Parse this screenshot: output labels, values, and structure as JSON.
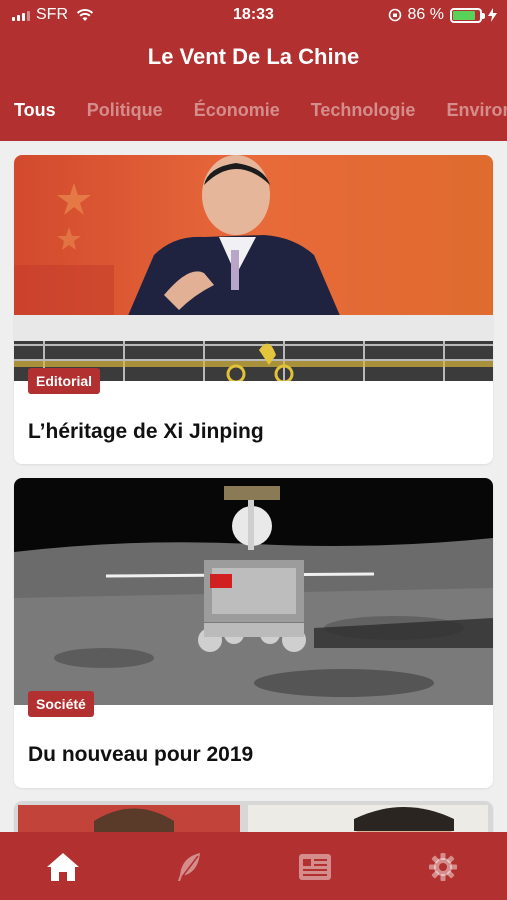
{
  "status_bar": {
    "carrier": "SFR",
    "time": "18:33",
    "battery_percent": "86 %",
    "battery_level": 0.86
  },
  "header": {
    "title": "Le Vent De La Chine"
  },
  "tabs": [
    {
      "label": "Tous",
      "active": true
    },
    {
      "label": "Politique",
      "active": false
    },
    {
      "label": "Économie",
      "active": false
    },
    {
      "label": "Technologie",
      "active": false
    },
    {
      "label": "Environ",
      "active": false
    }
  ],
  "articles": [
    {
      "category": "Editorial",
      "title": "L’héritage de Xi Jinping"
    },
    {
      "category": "Société",
      "title": "Du nouveau pour 2019"
    }
  ],
  "tab_bar": {
    "items": [
      {
        "icon": "home-icon",
        "active": true
      },
      {
        "icon": "feather-icon",
        "active": false
      },
      {
        "icon": "newspaper-icon",
        "active": false
      },
      {
        "icon": "gear-icon",
        "active": false
      }
    ]
  },
  "colors": {
    "brand": "#b2302f",
    "background": "#efefef",
    "battery_fill": "#5ad25a"
  }
}
